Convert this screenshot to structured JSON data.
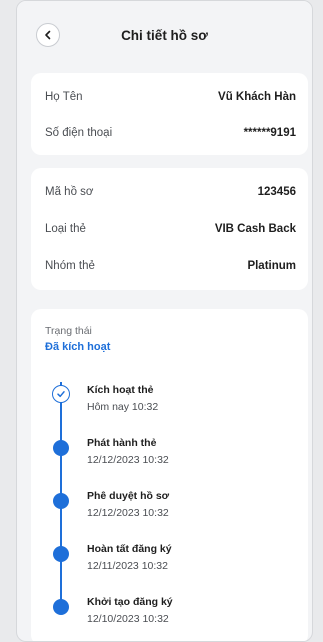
{
  "header": {
    "title": "Chi tiết hồ sơ",
    "back_icon": "chevron-left-icon"
  },
  "personal": {
    "name_label": "Họ Tên",
    "name_value": "Vũ Khách Hàn",
    "phone_label": "Số điện thoại",
    "phone_value": "******9191"
  },
  "card_info": {
    "file_label": "Mã hồ sơ",
    "file_value": "123456",
    "type_label": "Loại thẻ",
    "type_value": "VIB Cash Back",
    "group_label": "Nhóm thẻ",
    "group_value": "Platinum"
  },
  "status": {
    "label": "Trạng thái",
    "value": "Đã kích hoạt",
    "accent_color": "#1e6fd9",
    "steps": [
      {
        "title": "Kích hoạt thẻ",
        "time": "Hôm nay 10:32",
        "icon": "check-circle-icon"
      },
      {
        "title": "Phát hành thẻ",
        "time": "12/12/2023 10:32",
        "icon": "dot-icon"
      },
      {
        "title": "Phê duyệt hồ sơ",
        "time": "12/12/2023 10:32",
        "icon": "dot-icon"
      },
      {
        "title": "Hoàn tất đăng ký",
        "time": "12/11/2023 10:32",
        "icon": "dot-icon"
      },
      {
        "title": "Khởi tạo đăng ký",
        "time": "12/10/2023 10:32",
        "icon": "dot-icon"
      }
    ]
  }
}
